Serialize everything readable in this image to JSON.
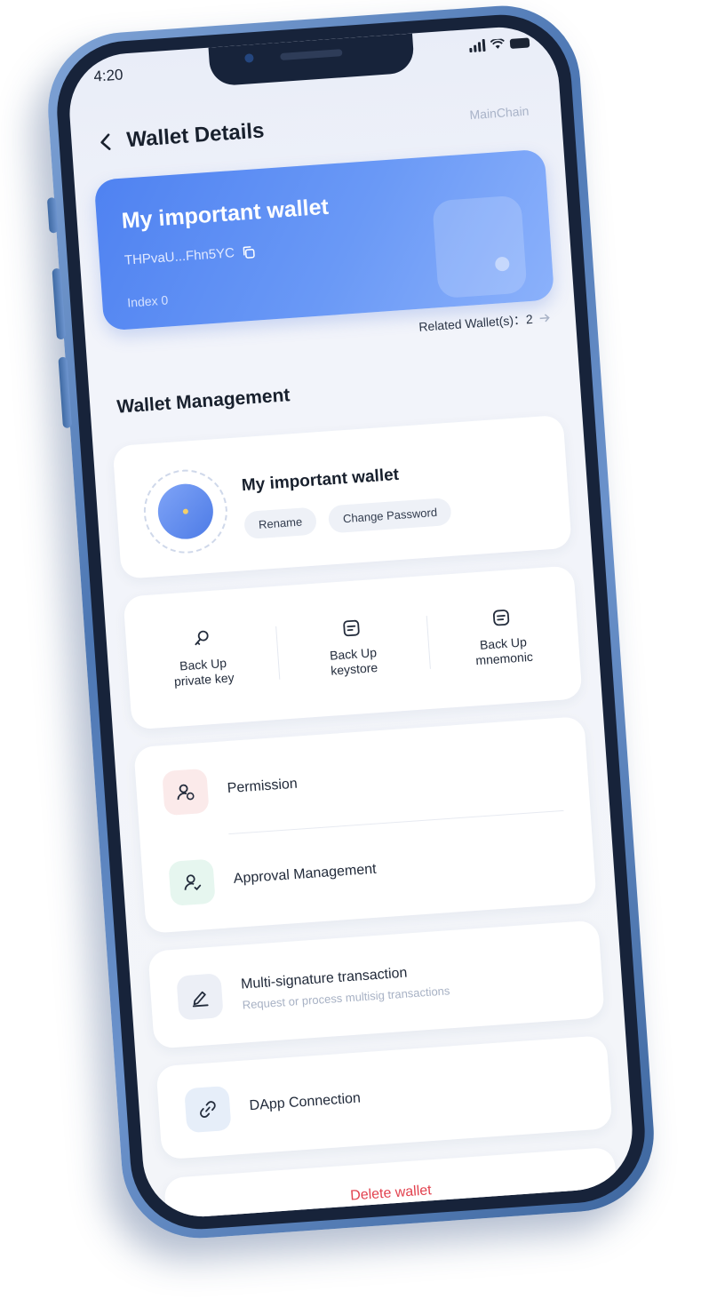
{
  "status_bar": {
    "time": "4:20"
  },
  "header": {
    "title": "Wallet Details",
    "chain": "MainChain"
  },
  "wallet_card": {
    "name": "My important wallet",
    "address": "THPvaU...Fhn5YC",
    "index": "Index  0"
  },
  "related": {
    "label": "Related Wallet(s)：2"
  },
  "management": {
    "title": "Wallet Management",
    "wallet_name": "My important wallet",
    "rename_label": "Rename",
    "change_password_label": "Change Password"
  },
  "backup": {
    "private_key": {
      "line1": "Back Up",
      "line2": "private key"
    },
    "keystore": {
      "line1": "Back Up",
      "line2": "keystore"
    },
    "mnemonic": {
      "line1": "Back Up",
      "line2": "mnemonic"
    }
  },
  "list": {
    "permission": "Permission",
    "approval": "Approval Management",
    "multisig_title": "Multi-signature transaction",
    "multisig_sub": "Request or process multisig transactions",
    "dapp": "DApp Connection"
  },
  "delete": {
    "label": "Delete wallet"
  },
  "colors": {
    "accent": "#4f82f1",
    "danger": "#e2424f",
    "phone_frame": "#4d77b3"
  }
}
